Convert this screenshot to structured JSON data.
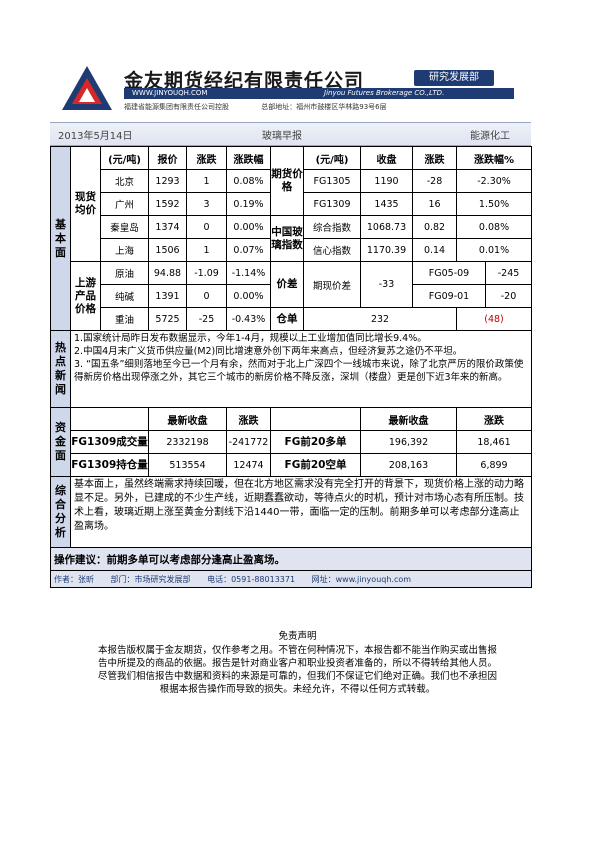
{
  "header": {
    "company_name": "金友期货经纪有限责任公司",
    "department_badge": "研究发展部",
    "website_banner": "WWW.JINYOUQH.COM",
    "company_en": "Jinyou Futures Brokerage CO.,LTD.",
    "shareholder": "福建省能源集团有限责任公司控股",
    "hq_address": "总部地址：福州市鼓楼区华林路93号6层"
  },
  "title_bar": {
    "date": "2013年5月14日",
    "report_name": "玻璃早报",
    "sector": "能源化工"
  },
  "fundamentals": {
    "section_label": "基本面",
    "spot_group_label": "现货均价",
    "spot_headers": [
      "(元/吨)",
      "报价",
      "涨跌",
      "涨跌幅"
    ],
    "spot_rows": [
      {
        "city": "北京",
        "price": "1293",
        "change": "1",
        "pct": "0.08%"
      },
      {
        "city": "广州",
        "price": "1592",
        "change": "3",
        "pct": "0.19%"
      },
      {
        "city": "秦皇岛",
        "price": "1374",
        "change": "0",
        "pct": "0.00%"
      },
      {
        "city": "上海",
        "price": "1506",
        "change": "1",
        "pct": "0.07%"
      }
    ],
    "futures_group_label": "期货价格",
    "futures_headers": [
      "(元/吨)",
      "收盘",
      "涨跌",
      "涨跌幅%"
    ],
    "futures_rows": [
      {
        "contract": "FG1305",
        "close": "1190",
        "change": "-28",
        "pct": "-2.30%"
      },
      {
        "contract": "FG1309",
        "close": "1435",
        "change": "16",
        "pct": "1.50%"
      }
    ],
    "index_group_label": "中国玻璃指数",
    "index_rows": [
      {
        "name": "综合指数",
        "value": "1068.73",
        "change": "0.82",
        "pct": "0.08%"
      },
      {
        "name": "信心指数",
        "value": "1170.39",
        "change": "0.14",
        "pct": "0.01%"
      }
    ],
    "upstream_group_label": "上游产品价格",
    "upstream_rows": [
      {
        "name": "原油",
        "price": "94.88",
        "change": "-1.09",
        "pct": "-1.14%"
      },
      {
        "name": "纯碱",
        "price": "1391",
        "change": "0",
        "pct": "0.00%"
      },
      {
        "name": "重油",
        "price": "5725",
        "change": "-25",
        "pct": "-0.43%"
      }
    ],
    "spread_label": "价差",
    "spread_name": "期现价差",
    "spread_value": "-33",
    "spread_pairs": [
      {
        "pair": "FG05-09",
        "value": "-245"
      },
      {
        "pair": "FG09-01",
        "value": "-20"
      }
    ],
    "warehouse_label": "仓单",
    "warehouse_value": "232",
    "warehouse_change": "(48)"
  },
  "news": {
    "section_label": "热点新闻",
    "items": [
      "1.国家统计局昨日发布数据显示，今年1-4月，规模以上工业增加值同比增长9.4%。",
      "2.中国4月末广义货币供应量(M2)同比增速意外创下两年来高点，但经济复苏之途仍不平坦。",
      "3. “国五条”细则落地至今已一个月有余，然而对于北上广深四个一线城市来说，除了北京严厉的限价政策使得新房价格出现停涨之外，其它三个城市的新房价格不降反涨，深圳（楼盘）更是创下近3年来的新高。"
    ]
  },
  "capital": {
    "section_label": "资金面",
    "headers": [
      "最新收盘",
      "涨跌",
      "最新收盘",
      "涨跌"
    ],
    "rows": [
      {
        "left_label": "FG1309成交量",
        "left_value": "2332198",
        "left_change": "-241772",
        "right_label": "FG前20多单",
        "right_value": "196,392",
        "right_change": "18,461"
      },
      {
        "left_label": "FG1309持仓量",
        "left_value": "513554",
        "left_change": "12474",
        "right_label": "FG前20空单",
        "right_value": "208,163",
        "right_change": "6,899"
      }
    ]
  },
  "analysis": {
    "section_label": "综合分析",
    "text": "基本面上，虽然终端需求持续回暖，但在北方地区需求没有完全打开的背景下，现货价格上涨的动力略显不足。另外，已建成的不少生产线，近期蠢蠢欲动，等待点火的时机，预计对市场心态有所压制。技术上看，玻璃近期上涨至黄金分割线下沿1440一带，面临一定的压制。前期多单可以考虑部分逢高止盈离场。"
  },
  "advice": "操作建议：前期多单可以考虑部分逢高止盈离场。",
  "footer": {
    "author": "作者：张昕",
    "department": "部门：市场研究发展部",
    "phone": "电话：0591-88013371",
    "website": "网址：www.jinyouqh.com"
  },
  "disclaimer": {
    "title": "免责声明",
    "lines": [
      "本报告版权属于金友期货，仅作参考之用。不管在何种情况下，本报告都不能当作购买或出售报",
      "告中所提及的商品的依据。报告是针对商业客户和职业投资者准备的，所以不得转给其他人员。",
      "尽管我们相信报告中数据和资料的来源是可靠的，但我们不保证它们绝对正确。我们也不承担因",
      "根据本报告操作而导致的损失。未经允许，不得以任何方式转载。"
    ]
  }
}
